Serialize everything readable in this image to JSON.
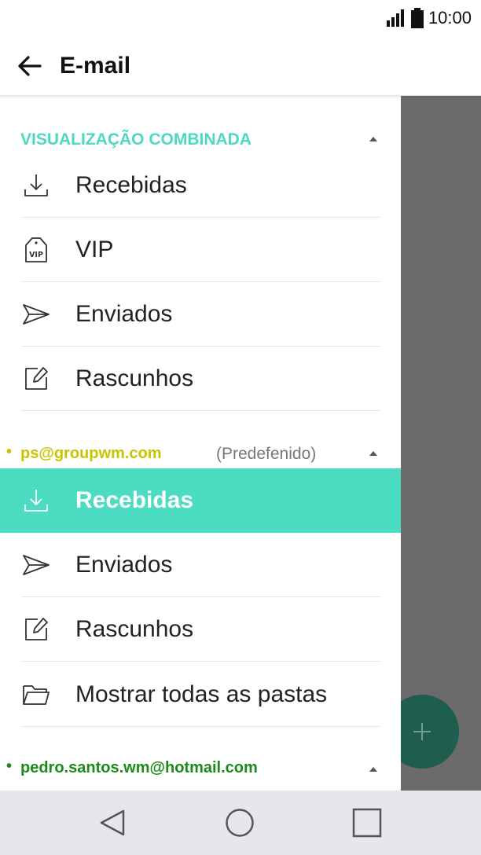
{
  "status_bar": {
    "time": "10:00",
    "icons": [
      "signal-icon",
      "battery-icon"
    ]
  },
  "app_bar": {
    "title": "E-mail",
    "back_icon": "arrow-left-icon"
  },
  "combined_view": {
    "title": "VISUALIZAÇÃO COMBINADA",
    "items": [
      {
        "label": "Recebidas",
        "icon": "inbox-download-icon"
      },
      {
        "label": "VIP",
        "icon": "vip-tag-icon"
      },
      {
        "label": "Enviados",
        "icon": "send-icon"
      },
      {
        "label": "Rascunhos",
        "icon": "edit-draft-icon"
      }
    ]
  },
  "account1": {
    "bullet": "•",
    "email": "ps@groupwm.com",
    "default_label": "(Predefenido)",
    "items": [
      {
        "label": "Recebidas",
        "icon": "inbox-download-icon",
        "active": true
      },
      {
        "label": "Enviados",
        "icon": "send-icon"
      },
      {
        "label": "Rascunhos",
        "icon": "edit-draft-icon"
      },
      {
        "label": "Mostrar todas as pastas",
        "icon": "folder-icon"
      }
    ]
  },
  "account2": {
    "bullet": "•",
    "email": "pedro.santos.wm@hotmail.com"
  },
  "colors": {
    "accent": "#4cd9bf",
    "active_row": "#4bdcc2",
    "account1_email": "#c9c400",
    "account2_email": "#1a8a1a",
    "fab": "#1f5d4e",
    "scrim": "#6b6b6b",
    "navbar": "#e6e7ec"
  },
  "fab": {
    "icon": "plus-icon"
  },
  "nav_bar": {
    "icons": [
      "back-triangle-icon",
      "home-circle-icon",
      "recents-square-icon"
    ]
  }
}
